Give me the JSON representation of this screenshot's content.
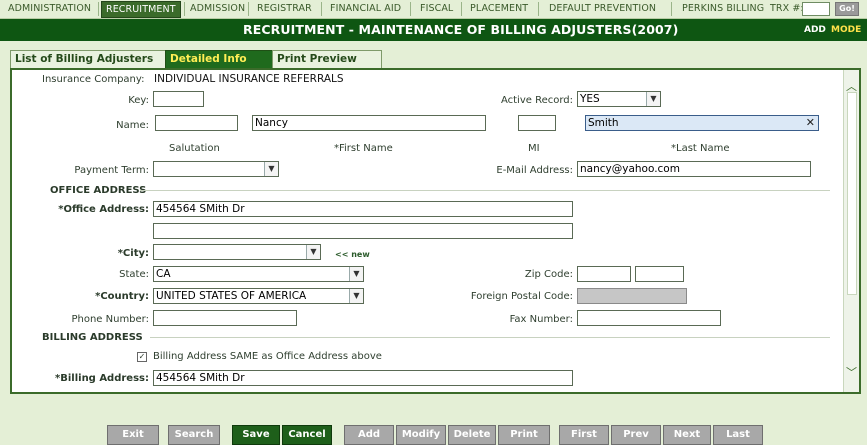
{
  "nav": {
    "items": [
      "ADMINISTRATION",
      "RECRUITMENT",
      "ADMISSION",
      "REGISTRAR",
      "FINANCIAL AID",
      "FISCAL",
      "PLACEMENT",
      "DEFAULT PREVENTION",
      "PERKINS BILLING"
    ],
    "trx_label": "TRX #:",
    "trx_value": "",
    "go_label": "Go!"
  },
  "header": {
    "title": "RECRUITMENT - MAINTENANCE OF BILLING ADJUSTERS(2007)",
    "add": "ADD",
    "mode": "MODE"
  },
  "tabs": [
    "List of Billing Adjusters",
    "Detailed Info",
    "Print Preview"
  ],
  "form": {
    "insurance_company_label": "Insurance Company:",
    "insurance_company_value": "INDIVIDUAL INSURANCE REFERRALS",
    "key_label": "Key:",
    "key_value": "",
    "active_record_label": "Active Record:",
    "active_record_value": "YES",
    "name_label": "Name:",
    "salutation_value": "",
    "first_name_value": "Nancy",
    "mi_value": "",
    "last_name_value": "Smith",
    "salutation_caption": "Salutation",
    "first_name_caption": "*First Name",
    "mi_caption": "MI",
    "last_name_caption": "*Last Name",
    "payment_term_label": "Payment Term:",
    "payment_term_value": "",
    "email_label": "E-Mail Address:",
    "email_value": "nancy@yahoo.com",
    "office_section": "OFFICE ADDRESS",
    "office_address_label": "*Office Address:",
    "office_address_line1": "454564 SMith Dr",
    "office_address_line2": "",
    "city_label": "*City:",
    "city_value": "",
    "new_link": "<< new",
    "state_label": "State:",
    "state_value": "CA",
    "zip_label": "Zip Code:",
    "zip_value": "",
    "zip_ext_value": "",
    "country_label": "*Country:",
    "country_value": "UNITED STATES OF AMERICA",
    "foreign_postal_label": "Foreign Postal Code:",
    "foreign_postal_value": "",
    "phone_label": "Phone Number:",
    "phone_value": "",
    "fax_label": "Fax Number:",
    "fax_value": "",
    "billing_section": "BILLING ADDRESS",
    "billing_same_label": "Billing Address SAME as Office Address above",
    "billing_same_checked": "✓",
    "billing_address_label": "*Billing Address:",
    "billing_address_line1": "454564 SMith Dr"
  },
  "toolbar": {
    "buttons": [
      "Exit",
      "Search",
      "Save",
      "Cancel",
      "Add",
      "Modify",
      "Delete",
      "Print",
      "First",
      "Prev",
      "Next",
      "Last"
    ]
  },
  "colors": {
    "title_bar": "#0e5612",
    "active_tab": "#1f6a1d",
    "mode_text": "#ffe24a",
    "save_button": "#1e5f1a"
  }
}
